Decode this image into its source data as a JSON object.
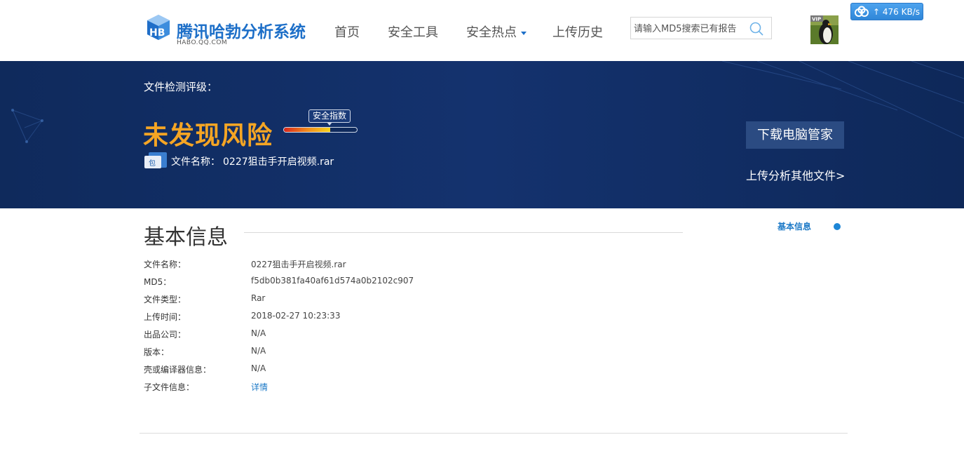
{
  "header": {
    "logo": {
      "title": "腾讯哈勃分析系统",
      "subtitle": "HABO.QQ.COM",
      "brand_color": "#1d6fc8"
    },
    "nav": [
      {
        "label": "首页",
        "has_caret": false
      },
      {
        "label": "安全工具",
        "has_caret": false
      },
      {
        "label": "安全热点",
        "has_caret": true
      },
      {
        "label": "上传历史",
        "has_caret": false
      }
    ],
    "search": {
      "placeholder": "请输入MD5搜索已有报告",
      "icon": "search-icon"
    },
    "avatar": {
      "badge": "VIP",
      "icon": "penguin-avatar"
    },
    "speed_badge": {
      "text": "476 KB/s",
      "icon": "cloud-icon",
      "arrow": "↑"
    }
  },
  "banner": {
    "rating_label": "文件检测评级：",
    "verdict": "未发现风险",
    "verdict_color": "#f5a524",
    "meter": {
      "label": "安全指数",
      "level": 0.63
    },
    "file_label": "文件名称：",
    "file_name": "0227狙击手开启视频.rar",
    "file_icon_text": "包",
    "download_button": "下载电脑管家",
    "upload_link": "上传分析其他文件>"
  },
  "basic_info": {
    "title": "基本信息",
    "side_nav": "基本信息",
    "rows": [
      {
        "key": "文件名称：",
        "value": "0227狙击手开启视频.rar"
      },
      {
        "key": "MD5：",
        "value": "f5db0b381fa40af61d574a0b2102c907"
      },
      {
        "key": "文件类型：",
        "value": "Rar"
      },
      {
        "key": "上传时间：",
        "value": "2018-02-27 10:23:33"
      },
      {
        "key": "出品公司：",
        "value": "N/A"
      },
      {
        "key": "版本：",
        "value": "N/A"
      },
      {
        "key": "壳或编译器信息：",
        "value": "N/A"
      },
      {
        "key": "子文件信息：",
        "value": "详情",
        "is_link": true
      }
    ]
  }
}
